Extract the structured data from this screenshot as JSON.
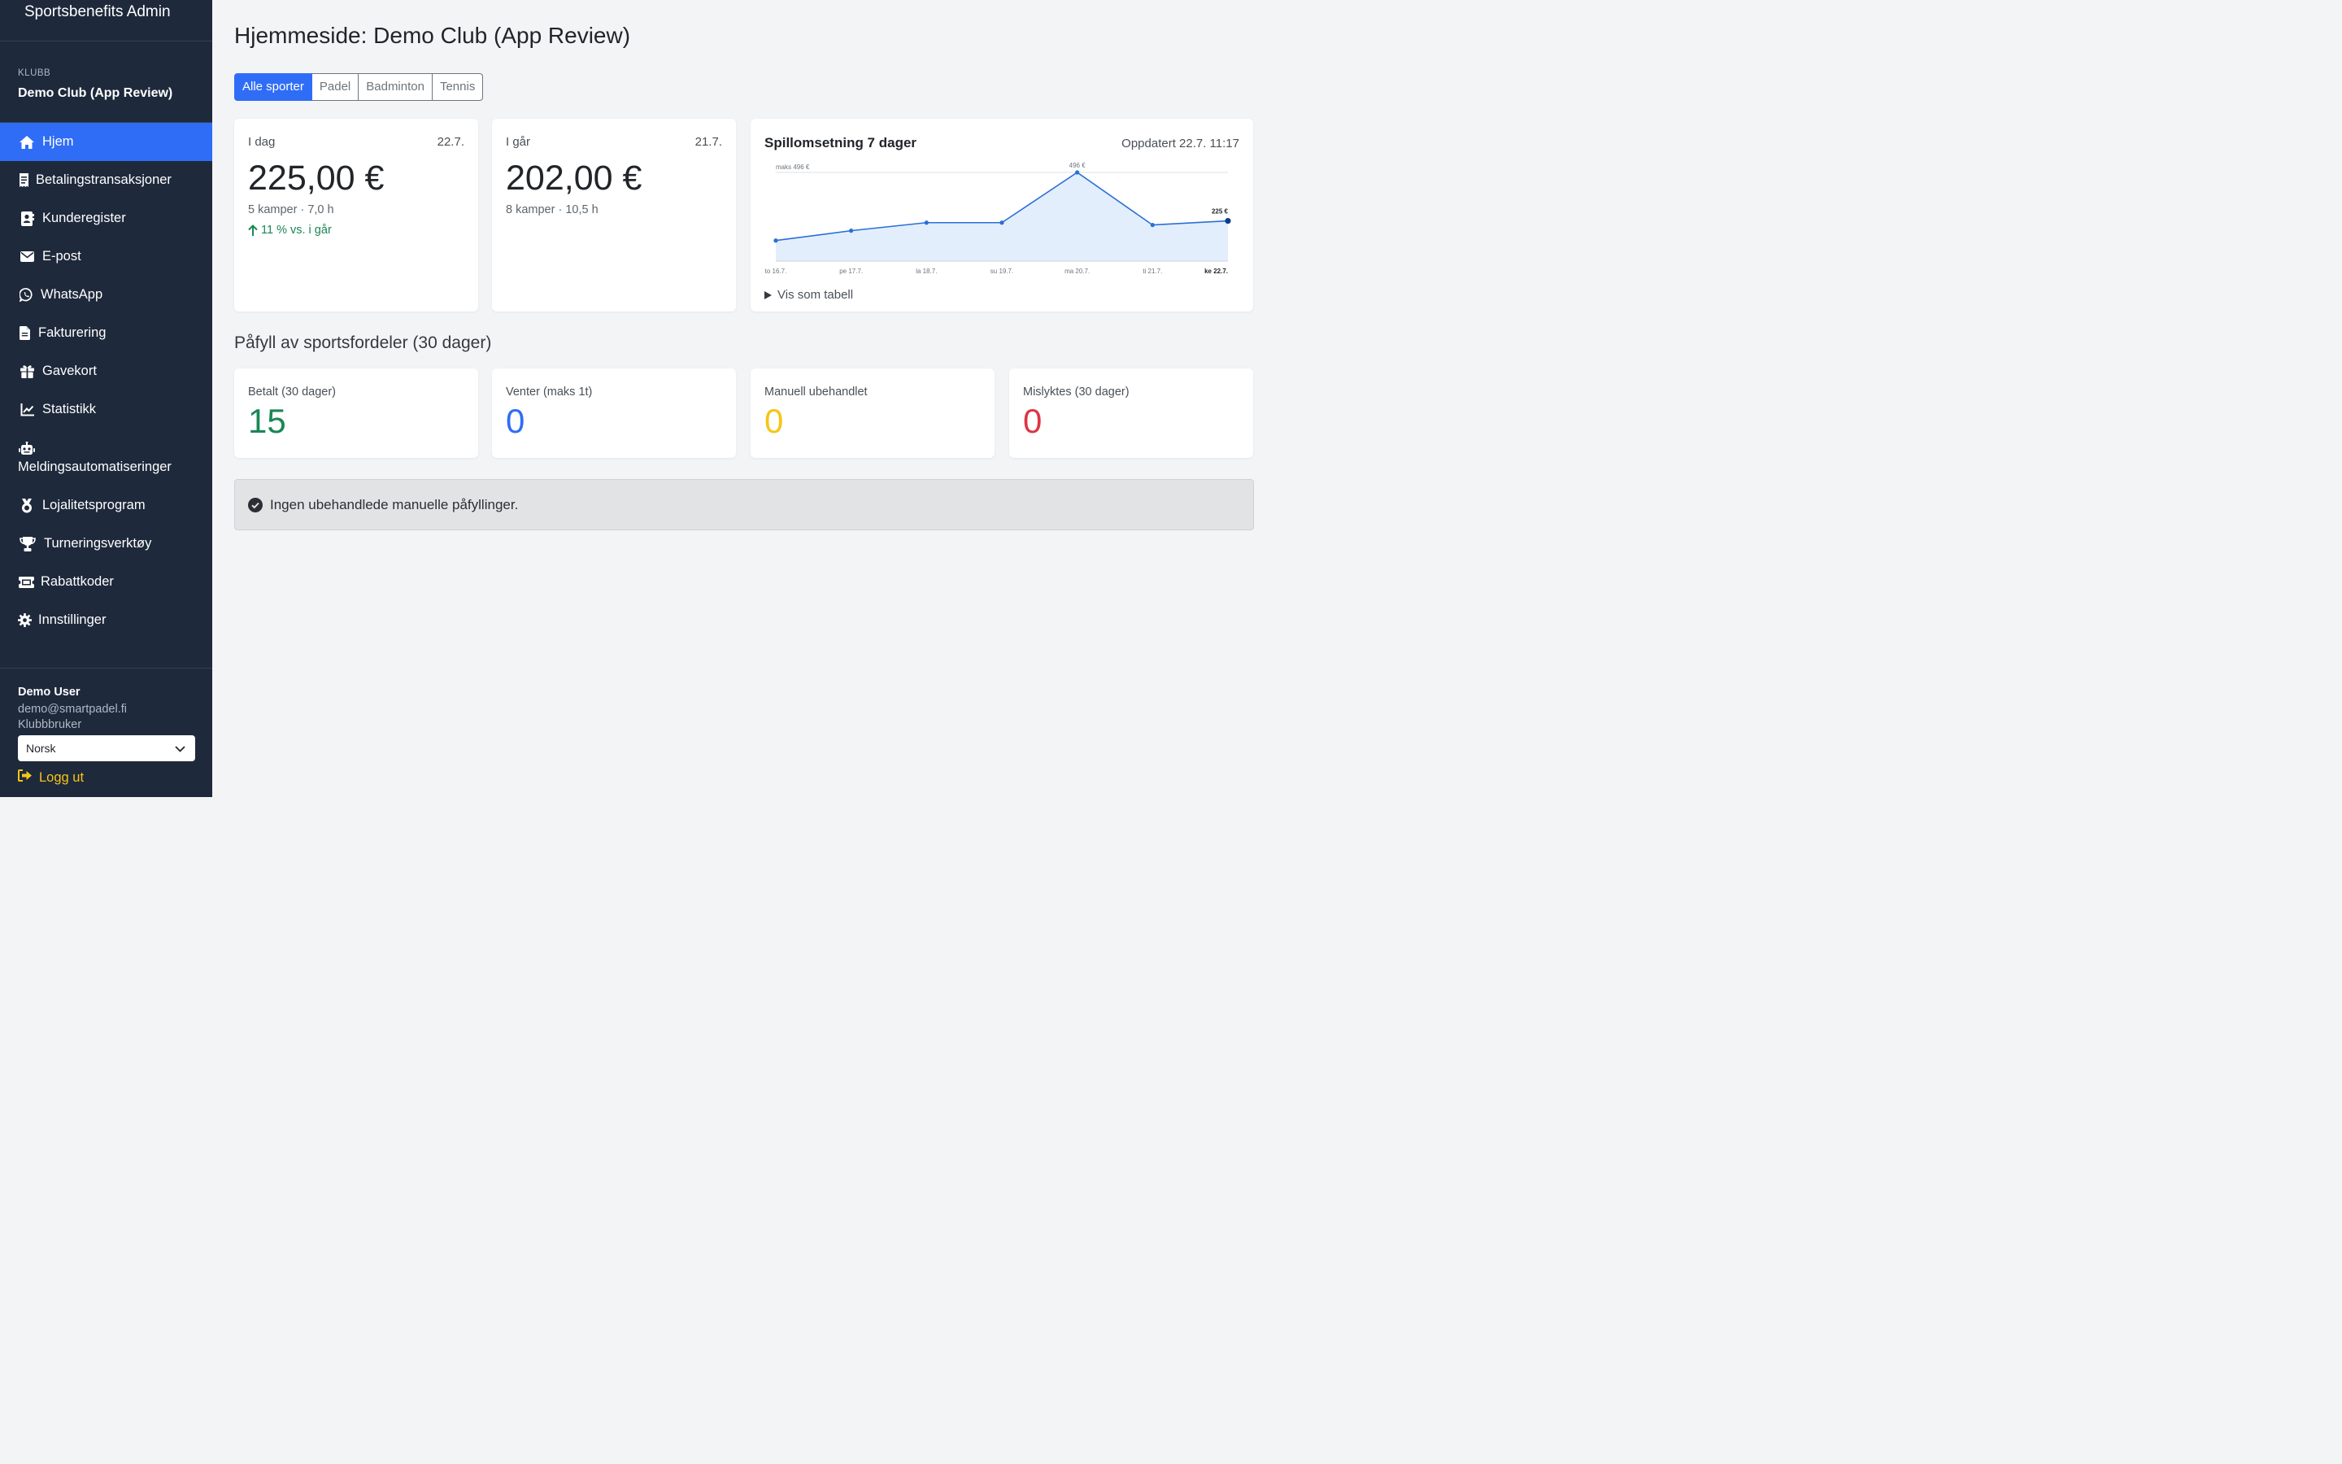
{
  "app": {
    "title": "Sportsbenefits Admin"
  },
  "club": {
    "label": "KLUBB",
    "name": "Demo Club (App Review)"
  },
  "nav": [
    {
      "label": "Hjem",
      "icon": "home-icon",
      "active": true
    },
    {
      "label": "Betalingstransaksjoner",
      "icon": "receipt-icon"
    },
    {
      "label": "Kunderegister",
      "icon": "contact-book-icon"
    },
    {
      "label": "E-post",
      "icon": "envelope-icon"
    },
    {
      "label": "WhatsApp",
      "icon": "whatsapp-icon"
    },
    {
      "label": "Fakturering",
      "icon": "invoice-icon"
    },
    {
      "label": "Gavekort",
      "icon": "gift-icon"
    },
    {
      "label": "Statistikk",
      "icon": "line-chart-icon"
    },
    {
      "label": "Meldingsautomatiseringer",
      "icon": "robot-icon"
    },
    {
      "label": "Lojalitetsprogram",
      "icon": "medal-icon"
    },
    {
      "label": "Turneringsverktøy",
      "icon": "trophy-icon"
    },
    {
      "label": "Rabattkoder",
      "icon": "ticket-icon"
    },
    {
      "label": "Innstillinger",
      "icon": "gear-icon"
    }
  ],
  "user": {
    "name": "Demo User",
    "email": "demo@smartpadel.fi",
    "role": "Klubbbruker",
    "language": "Norsk",
    "logout_label": "Logg ut"
  },
  "page": {
    "title": "Hjemmeside: Demo Club (App Review)"
  },
  "sport_tabs": [
    {
      "label": "Alle sporter",
      "active": true
    },
    {
      "label": "Padel"
    },
    {
      "label": "Badminton"
    },
    {
      "label": "Tennis"
    }
  ],
  "today": {
    "label": "I dag",
    "date": "22.7.",
    "amount": "225,00 €",
    "sub": "5 kamper · 7,0 h",
    "delta": "11 % vs. i går"
  },
  "yesterday": {
    "label": "I går",
    "date": "21.7.",
    "amount": "202,00 €",
    "sub": "8 kamper · 10,5 h"
  },
  "revenue_chart": {
    "title": "Spillomsetning 7 dager",
    "updated": "Oppdatert 22.7. 11:17",
    "max_label": "maks 496 €",
    "peak_label": "496 €",
    "last_label": "225 €",
    "toggle_label": "Vis som tabell",
    "line_color": "#2a6fd6",
    "fill_color": "#e3eefc"
  },
  "chart_data": {
    "type": "area",
    "categories": [
      "to 16.7.",
      "pe 17.7.",
      "la 18.7.",
      "su 19.7.",
      "ma 20.7.",
      "ti 21.7.",
      "ke 22.7."
    ],
    "values": [
      115,
      170,
      215,
      215,
      496,
      202,
      225
    ],
    "ylim": [
      0,
      496
    ],
    "grid": false
  },
  "refill_section": {
    "title": "Påfyll av sportsfordeler (30 dager)"
  },
  "refill_stats": [
    {
      "label": "Betalt (30 dager)",
      "value": "15",
      "color": "#198754"
    },
    {
      "label": "Venter (maks 1t)",
      "value": "0",
      "color": "#2f6df6"
    },
    {
      "label": "Manuell ubehandlet",
      "value": "0",
      "color": "#f5c518"
    },
    {
      "label": "Mislyktes (30 dager)",
      "value": "0",
      "color": "#dc3545"
    }
  ],
  "alert": {
    "text": "Ingen ubehandlede manuelle påfyllinger."
  }
}
